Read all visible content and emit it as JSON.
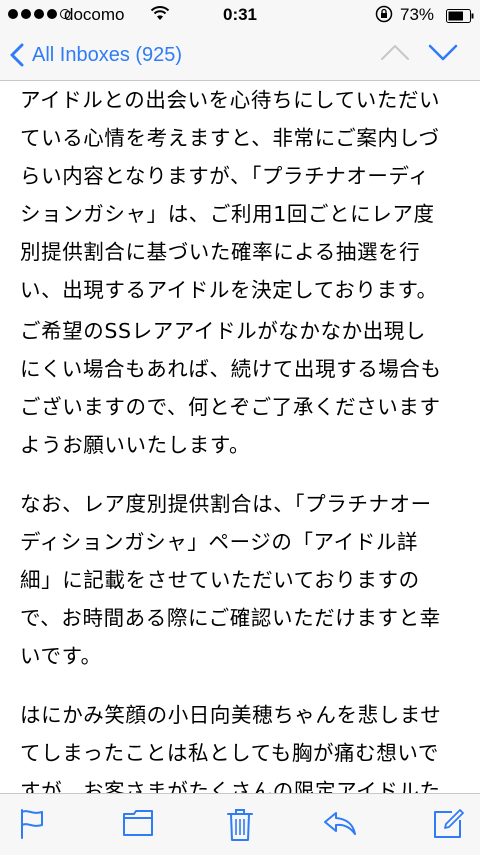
{
  "status_bar": {
    "carrier": "docomo",
    "time": "0:31",
    "battery": "73%",
    "icons": [
      "signal-dots",
      "wifi-icon",
      "orientation-lock-icon",
      "battery-icon"
    ]
  },
  "nav": {
    "back_label": "All Inboxes (925)",
    "icons": [
      "chevron-left-icon",
      "chevron-up-icon",
      "chevron-down-icon"
    ]
  },
  "message": {
    "paragraphs": [
      {
        "lines": [
          "アイドルとの出会いを心待ちにしていただい",
          "ている心情を考えますと、非常にご案内しづ",
          "らい内容となりますが、「プラチナオーディ",
          "ションガシャ」は、ご利用1回ごとにレア度",
          "別提供割合に基づいた確率による抽選を行",
          "い、出現するアイドルを決定しております。"
        ]
      },
      {
        "lines": [
          "ご希望のSSレアアイドルがなかなか出現し",
          "にくい場合もあれば、続けて出現する場合も",
          "ございますので、何とぞご了承くださいます",
          "ようお願いいたします。"
        ]
      },
      {
        "lines": [
          "なお、レア度別提供割合は、「プラチナオー",
          "ディションガシャ」ページの「アイドル詳",
          "細」に記載をさせていただいておりますの",
          "で、お時間ある際にご確認いただけますと幸",
          "いです。"
        ]
      },
      {
        "lines": [
          "はにかみ笑顔の小日向美穂ちゃんを悲しませ",
          "てしまったことは私としても胸が痛む想いで",
          "すが、お客さまがたくさんの限定アイドルた"
        ]
      }
    ]
  },
  "toolbar": {
    "icons": [
      "flag-icon",
      "folder-icon",
      "trash-icon",
      "reply-icon",
      "compose-icon"
    ]
  },
  "colors": {
    "accent": "#2f7cf6",
    "bar_bg": "#f7f7f7",
    "separator": "#c8c7cc",
    "disabled": "#c7c7cc"
  }
}
